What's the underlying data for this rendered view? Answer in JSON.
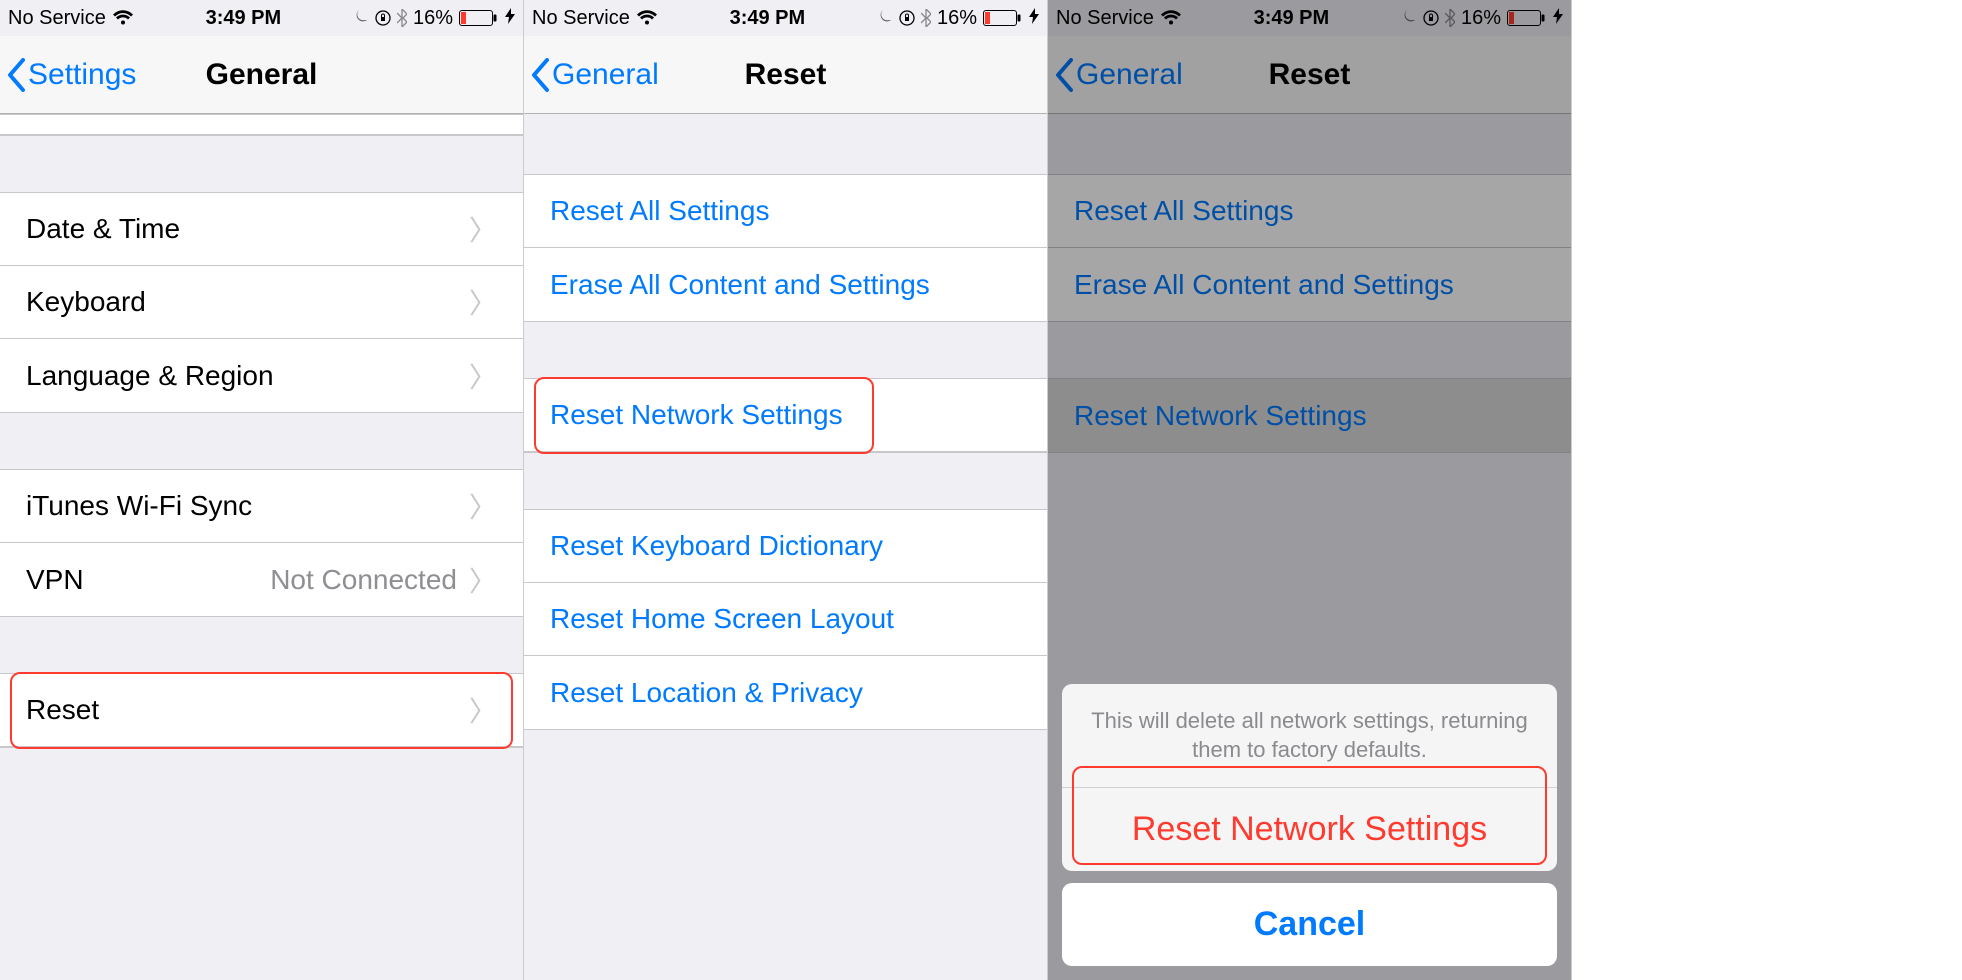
{
  "statusbar": {
    "carrier": "No Service",
    "time": "3:49 PM",
    "battery_pct": "16%"
  },
  "screens": [
    {
      "back_label": "Settings",
      "title": "General",
      "group1": [
        {
          "label": "Date & Time"
        },
        {
          "label": "Keyboard"
        },
        {
          "label": "Language & Region"
        }
      ],
      "group2": [
        {
          "label": "iTunes Wi-Fi Sync"
        },
        {
          "label": "VPN",
          "detail": "Not Connected"
        }
      ],
      "group3": [
        {
          "label": "Reset"
        }
      ]
    },
    {
      "back_label": "General",
      "title": "Reset",
      "group1": [
        {
          "label": "Reset All Settings"
        },
        {
          "label": "Erase All Content and Settings"
        }
      ],
      "group2": [
        {
          "label": "Reset Network Settings"
        }
      ],
      "group3": [
        {
          "label": "Reset Keyboard Dictionary"
        },
        {
          "label": "Reset Home Screen Layout"
        },
        {
          "label": "Reset Location & Privacy"
        }
      ]
    },
    {
      "back_label": "General",
      "title": "Reset",
      "group1": [
        {
          "label": "Reset All Settings"
        },
        {
          "label": "Erase All Content and Settings"
        }
      ],
      "group2": [
        {
          "label": "Reset Network Settings"
        }
      ],
      "actionsheet": {
        "message": "This will delete all network settings, returning them to factory defaults.",
        "destructive": "Reset Network Settings",
        "cancel": "Cancel"
      }
    }
  ]
}
